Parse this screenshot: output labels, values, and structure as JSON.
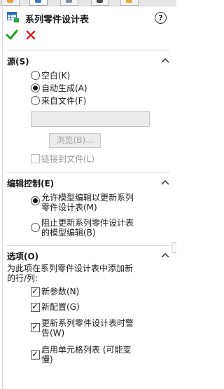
{
  "panel": {
    "title": "系列零件设计表",
    "help_icon_label": "?",
    "ok_icon": "check-icon",
    "cancel_icon": "close-icon",
    "colors": {
      "ok": "#22a022",
      "cancel": "#d42020",
      "accent": "#2e6fb3"
    }
  },
  "source": {
    "header": "源(S)",
    "options": [
      {
        "label": "空白(K)",
        "selected": false
      },
      {
        "label": "自动生成(A)",
        "selected": true
      },
      {
        "label": "来自文件(F)",
        "selected": false
      }
    ],
    "file_value": "",
    "browse_label": "浏览(B)...",
    "link_label": "链接到文件(L)",
    "link_checked": false
  },
  "edit_control": {
    "header": "编辑控制(E)",
    "options": [
      {
        "label_line1": "允许模型编辑以更新系列",
        "label_line2": "零件设计表(M)",
        "selected": true
      },
      {
        "label_line1": "阻止更新系列零件设计表",
        "label_line2": "的模型编辑(B)",
        "selected": false
      }
    ]
  },
  "options_section": {
    "header": "选项(O)",
    "description_line1": "为此项在系列零件设计表中添加新",
    "description_line2": "的行/列:",
    "checkboxes": [
      {
        "label_line1": "新参数(N)",
        "label_line2": "",
        "checked": true
      },
      {
        "label_line1": "新配置(G)",
        "label_line2": "",
        "checked": true
      },
      {
        "label_line1": "更新系列零件设计表时警",
        "label_line2": "告(W)",
        "checked": true
      },
      {
        "label_line1": "启用单元格列表 (可能变",
        "label_line2": "慢)",
        "checked": true
      }
    ]
  }
}
